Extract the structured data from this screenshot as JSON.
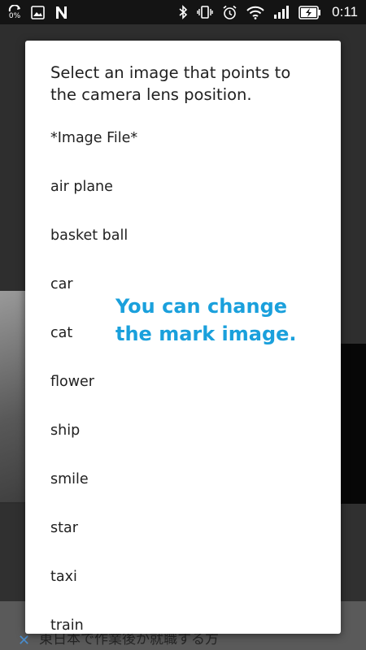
{
  "status_bar": {
    "data_saver_percent": "0%",
    "time": "0:11",
    "icons": [
      "data-saver-icon",
      "image-icon",
      "n-notification-icon",
      "bluetooth-icon",
      "vibrate-icon",
      "alarm-icon",
      "wifi-icon",
      "signal-icon",
      "battery-charging-icon"
    ]
  },
  "dialog": {
    "title": "Select an image that points to the camera lens position.",
    "options": [
      "*Image File*",
      "air plane",
      "basket ball",
      "car",
      "cat",
      "flower",
      "ship",
      "smile",
      "star",
      "taxi",
      "train"
    ]
  },
  "overlay_note": {
    "line1": "You can change",
    "line2": "the mark image.",
    "color": "#1aa0dc"
  },
  "ad_banner": {
    "text": "東日本で作業後か就職する方",
    "close_icon": "close-icon"
  }
}
